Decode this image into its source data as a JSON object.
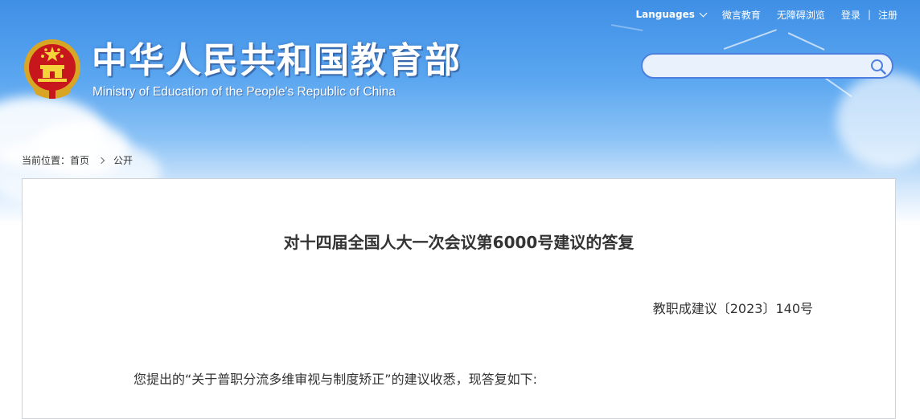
{
  "header": {
    "title_cn": "中华人民共和国教育部",
    "title_en": "Ministry of Education of the People's Republic of China"
  },
  "topnav": {
    "languages": "Languages",
    "weiyan": "微言教育",
    "accessible": "无障碍浏览",
    "login": "登录",
    "separator": "|",
    "register": "注册"
  },
  "search": {
    "placeholder": "",
    "value": ""
  },
  "breadcrumb": {
    "prefix": "当前位置：",
    "home": "首页",
    "current": "公开"
  },
  "article": {
    "title": "对十四届全国人大一次会议第6000号建议的答复",
    "doc_number": "教职成建议〔2023〕140号",
    "paragraph": "您提出的“关于普职分流多维审视与制度矫正”的建议收悉，现答复如下:"
  },
  "colors": {
    "header_blue": "#3f8fe6",
    "search_border": "#4d7fe0",
    "text": "#333333"
  },
  "icons": [
    "national-emblem-icon",
    "search-icon",
    "chevron-down-icon",
    "chevron-right-icon"
  ]
}
